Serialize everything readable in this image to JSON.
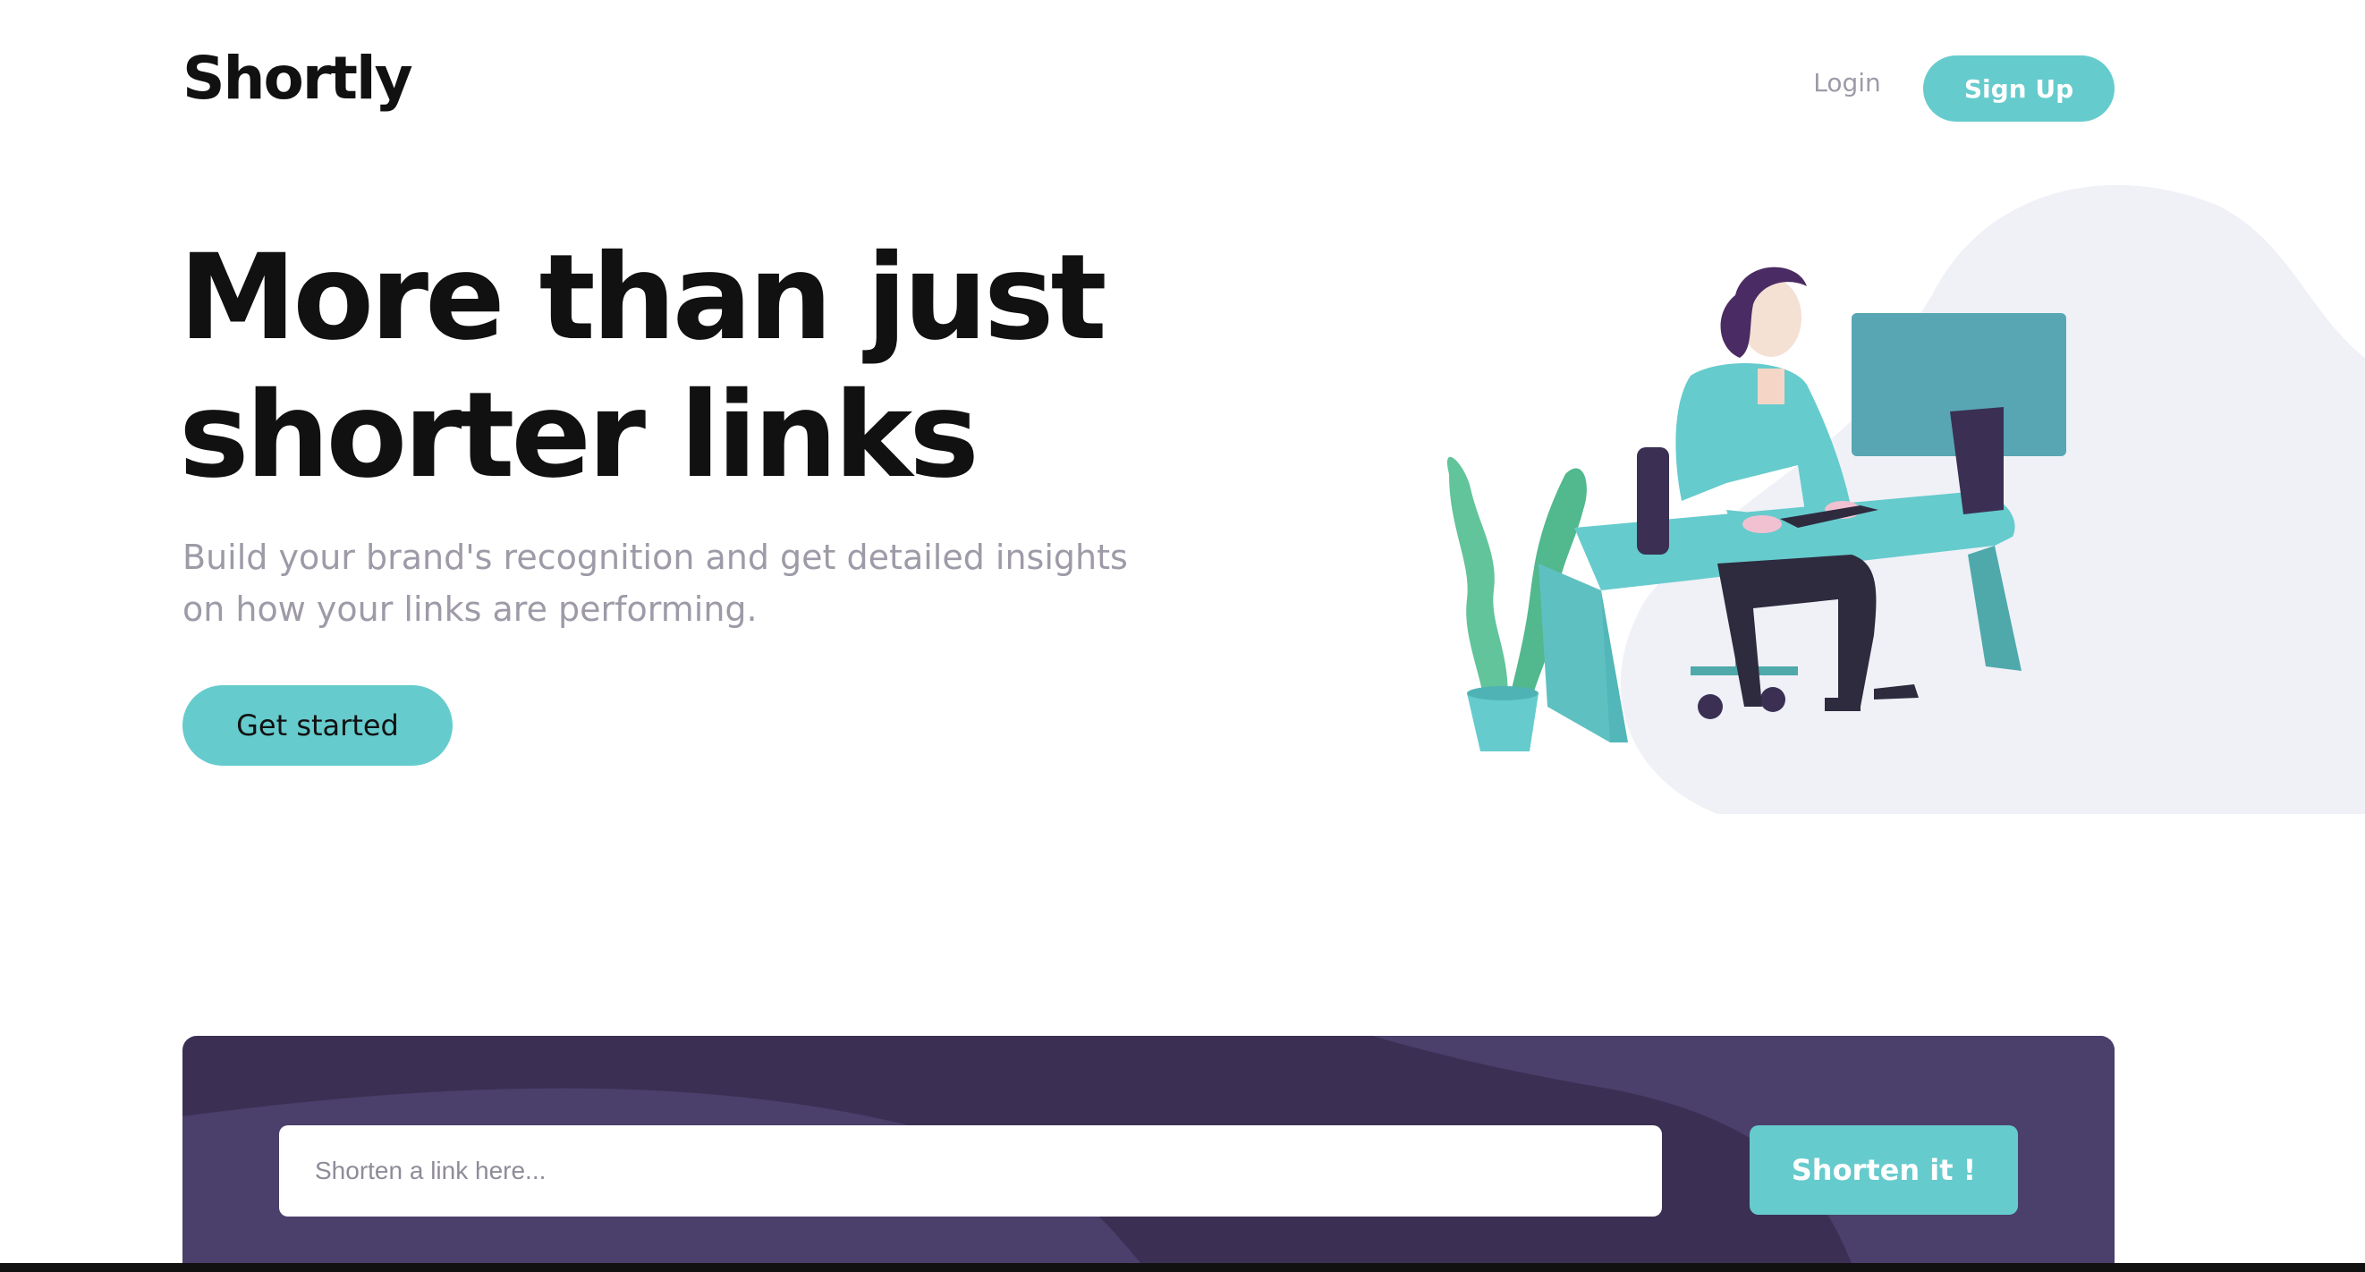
{
  "header": {
    "logo": "Shortly",
    "login_label": "Login",
    "signup_label": "Sign Up"
  },
  "hero": {
    "title_line1": "More than just",
    "title_line2": "shorter links",
    "subtitle": "Build your brand's recognition and get detailed insights on how your links are performing.",
    "cta_label": "Get started",
    "illustration": "person-working-at-desk-illustration"
  },
  "shorten": {
    "placeholder": "Shorten a link here...",
    "button_label": "Shorten it !"
  },
  "colors": {
    "accent": "#66cbcd",
    "dark_violet": "#3b3054",
    "violet_shape": "#4b3f6b",
    "gray_text": "#9e9aa7",
    "blob": "#eff1f7"
  }
}
